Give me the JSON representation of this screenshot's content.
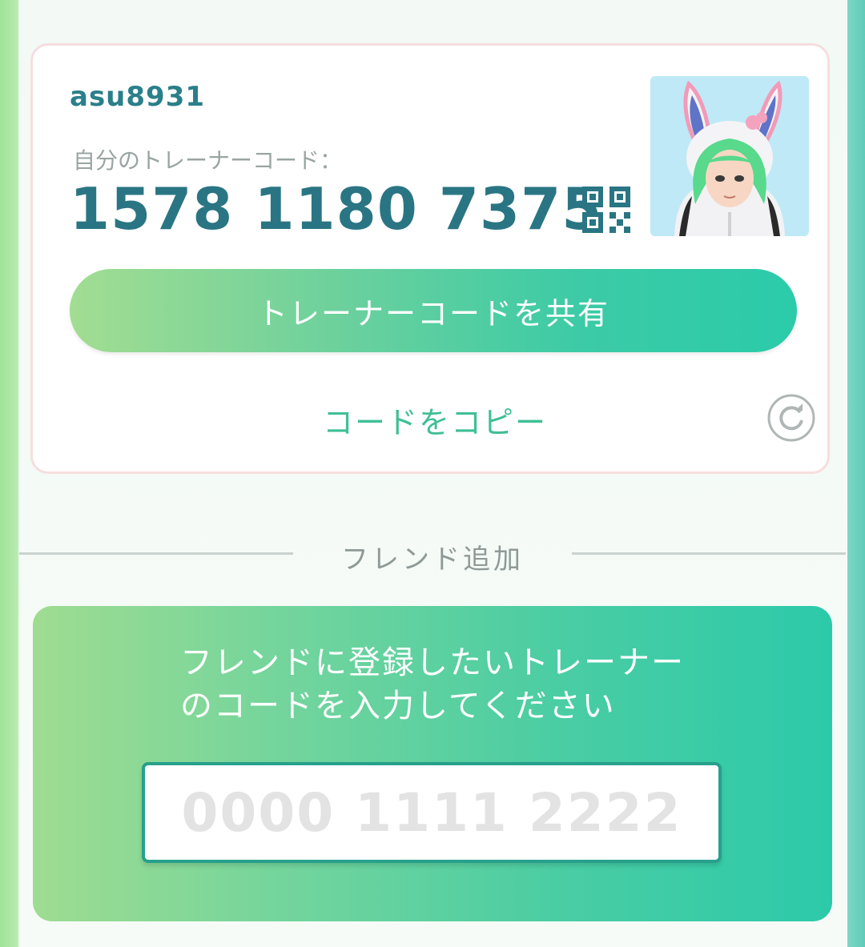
{
  "profile": {
    "username": "asu8931",
    "code_label": "自分のトレーナーコード：",
    "trainer_code": "1578 1180 7375"
  },
  "actions": {
    "share_label": "トレーナーコードを共有",
    "copy_label": "コードをコピー"
  },
  "friend_add": {
    "section_title": "フレンド追加",
    "instruction": "フレンドに登録したいトレーナーのコードを入力してください",
    "input_placeholder": "0000 1111 2222"
  },
  "icons": {
    "qr": "qr-code-icon",
    "refresh": "refresh-icon",
    "avatar": "trainer-avatar"
  },
  "colors": {
    "accent_teal": "#2a7583",
    "button_gradient_start": "#a2dd92",
    "button_gradient_end": "#2bcbaa",
    "copy_link": "#3fbf95"
  }
}
